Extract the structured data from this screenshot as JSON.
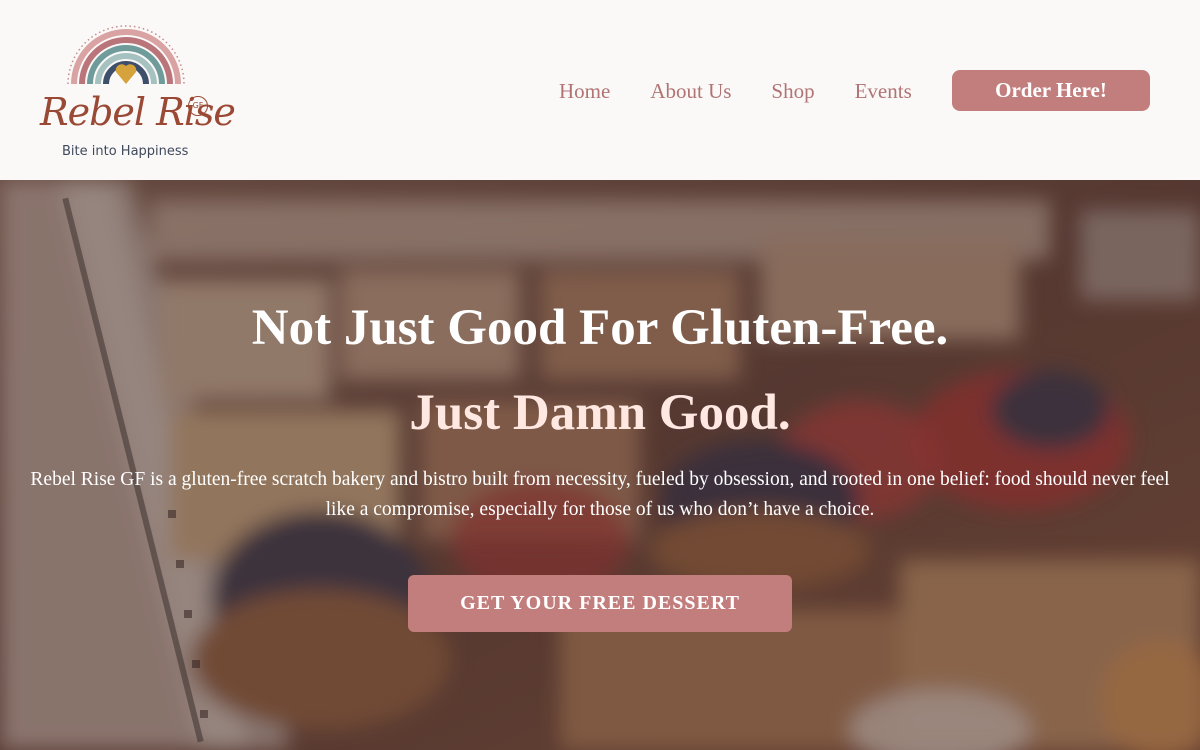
{
  "header": {
    "logo": {
      "name": "Rebel Rise",
      "badge": "GF",
      "tagline": "Bite into Happiness",
      "icon": "rainbow-heart-icon"
    },
    "nav": [
      {
        "label": "Home"
      },
      {
        "label": "About Us"
      },
      {
        "label": "Shop"
      },
      {
        "label": "Events"
      }
    ],
    "order_button": "Order Here!"
  },
  "hero": {
    "title": "Not Just Good For Gluten-Free.",
    "subtitle": "Just Damn Good.",
    "description": "Rebel Rise GF is a gluten-free scratch bakery and bistro built from necessity, fueled by obsession, and rooted in one belief: food should never feel like a compromise, especially for those of us who don’t have a choice.",
    "cta_button": "GET YOUR FREE DESSERT",
    "background": "bakery-pastries-display-image"
  },
  "colors": {
    "accent": "#c27d7d",
    "nav_text": "#b07474",
    "header_bg": "#fbf8f8",
    "logo_brown": "#9a4a34"
  }
}
